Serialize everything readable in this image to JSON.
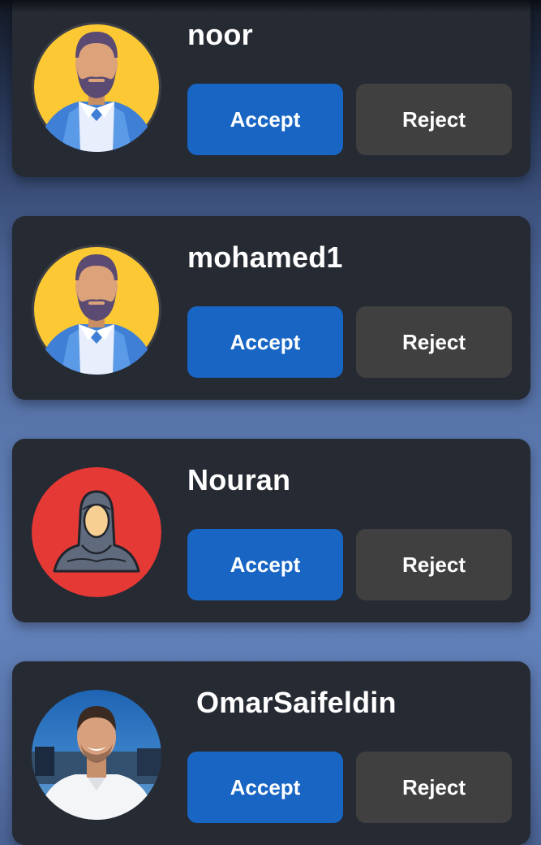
{
  "requests": [
    {
      "name": "noor",
      "avatar": "male-cartoon-avatar",
      "accept_label": "Accept",
      "reject_label": "Reject"
    },
    {
      "name": "mohamed1",
      "avatar": "male-cartoon-avatar",
      "accept_label": "Accept",
      "reject_label": "Reject"
    },
    {
      "name": "Nouran",
      "avatar": "hijab-woman-avatar",
      "accept_label": "Accept",
      "reject_label": "Reject"
    },
    {
      "name": "OmarSaifeldin",
      "avatar": "profile-photo",
      "accept_label": "Accept",
      "reject_label": "Reject"
    }
  ],
  "colors": {
    "card_background": "#262a33",
    "accept_button": "#1865c4",
    "reject_button": "#404040",
    "text": "#ffffff"
  }
}
